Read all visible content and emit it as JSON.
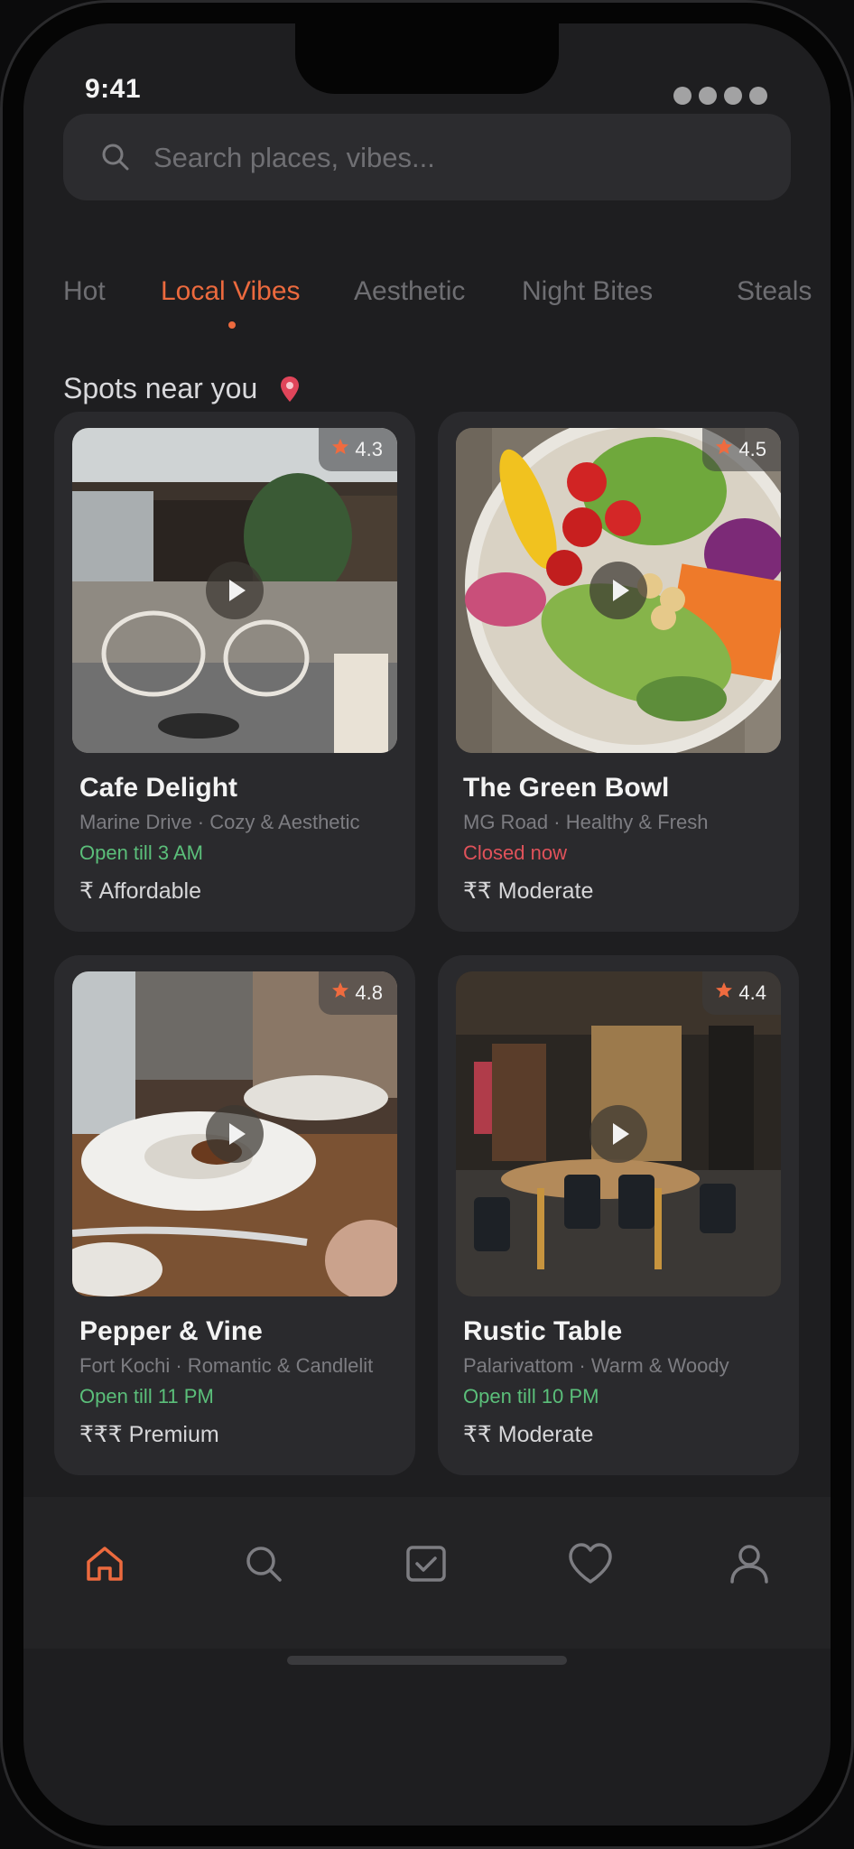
{
  "status_bar": {
    "time": "9:41"
  },
  "search": {
    "placeholder": "Search places, vibes..."
  },
  "tabs": [
    {
      "label": "Hot",
      "active": false
    },
    {
      "label": "Local Vibes",
      "active": true
    },
    {
      "label": "Aesthetic",
      "active": false
    },
    {
      "label": "Night Bites",
      "active": false
    },
    {
      "label": "Steals",
      "active": false
    }
  ],
  "section": {
    "title": "Spots near you"
  },
  "places": [
    {
      "name": "Cafe Delight",
      "subtitle": "Marine Drive · Cozy & Aesthetic",
      "status": "Open till 3 AM",
      "status_type": "open",
      "price": "₹ Affordable",
      "rating": "4.3"
    },
    {
      "name": "The Green Bowl",
      "subtitle": "MG Road · Healthy & Fresh",
      "status": "Closed now",
      "status_type": "closed",
      "price": "₹₹ Moderate",
      "rating": "4.5"
    },
    {
      "name": "Pepper & Vine",
      "subtitle": "Fort Kochi · Romantic & Candlelit",
      "status": "Open till 11 PM",
      "status_type": "open",
      "price": "₹₹₹ Premium",
      "rating": "4.8"
    },
    {
      "name": "Rustic Table",
      "subtitle": "Palarivattom · Warm & Woody",
      "status": "Open till 10 PM",
      "status_type": "open",
      "price": "₹₹ Moderate",
      "rating": "4.4"
    }
  ],
  "bottom_nav": [
    {
      "icon": "home-icon",
      "active": true
    },
    {
      "icon": "search-icon",
      "active": false
    },
    {
      "icon": "checkbox-icon",
      "active": false
    },
    {
      "icon": "heart-icon",
      "active": false
    },
    {
      "icon": "profile-icon",
      "active": false
    }
  ],
  "colors": {
    "accent": "#ec6a3e",
    "open": "#5bbf7a",
    "closed": "#e0525a",
    "background": "#1e1e20",
    "card": "#2a2a2d"
  }
}
